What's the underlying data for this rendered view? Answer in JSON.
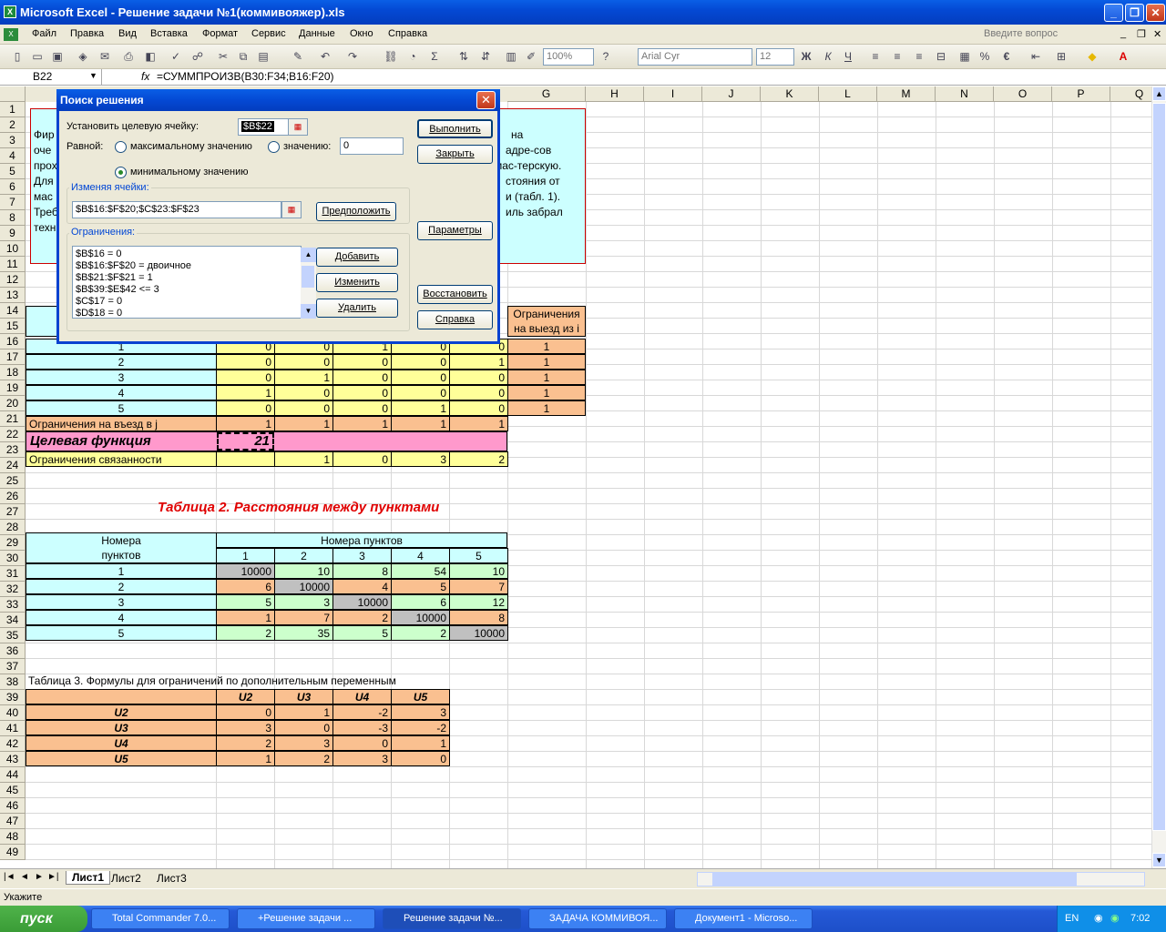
{
  "window": {
    "title": "Microsoft Excel - Решение задачи №1(коммивояжер).xls"
  },
  "menu": [
    "Файл",
    "Правка",
    "Вид",
    "Вставка",
    "Формат",
    "Сервис",
    "Данные",
    "Окно",
    "Справка"
  ],
  "ask_placeholder": "Введите вопрос",
  "toolbar": {
    "zoom": "100%",
    "font": "Arial Cyr",
    "size": "12"
  },
  "formula_bar": {
    "name_box": "B22",
    "fx": "fx",
    "formula": "=СУММПРОИЗВ(B30:F34;B16:F20)"
  },
  "columns": [
    "G",
    "H",
    "I",
    "J",
    "K",
    "L",
    "M",
    "N",
    "O",
    "P",
    "Q"
  ],
  "cells": {
    "r2": "Фир",
    "r3": "оче",
    "r4": "прох",
    "r5": "Для",
    "r6": "мас",
    "r7": "Треб",
    "r8": "техн",
    "r2b": "на",
    "r3b": "адре-сов",
    "r4b": "мас-терскую.",
    "r5b": "стояния от",
    "r6b": "и (табл. 1).",
    "r7b": "иль забрал",
    "g14": "Ограничения",
    "g15": "на выезд из i",
    "b16row": [
      "1",
      "0",
      "0",
      "1",
      "0",
      "0",
      "1"
    ],
    "rows16_20": [
      [
        "1",
        "0",
        "0",
        "1",
        "0",
        "0",
        "1"
      ],
      [
        "2",
        "0",
        "0",
        "0",
        "0",
        "1",
        "1"
      ],
      [
        "3",
        "0",
        "1",
        "0",
        "0",
        "0",
        "1"
      ],
      [
        "4",
        "1",
        "0",
        "0",
        "0",
        "0",
        "1"
      ],
      [
        "5",
        "0",
        "0",
        "0",
        "1",
        "0",
        "1"
      ]
    ],
    "r21": [
      "Ограничения на въезд в j",
      "1",
      "1",
      "1",
      "1",
      "1"
    ],
    "r22": [
      "Целевая функция",
      "21"
    ],
    "r23": [
      "Ограничения связанности",
      "",
      "1",
      "0",
      "3",
      "2"
    ],
    "t2title": "Таблица 2. Расстояния между пунктами",
    "t2_h1": "Номера",
    "t2_h2": "пунктов",
    "t2_h3": "Номера пунктов",
    "t2_cols": [
      "1",
      "2",
      "3",
      "4",
      "5"
    ],
    "t2_rows": [
      [
        "1",
        "10000",
        "10",
        "8",
        "54",
        "10"
      ],
      [
        "2",
        "6",
        "10000",
        "4",
        "5",
        "7"
      ],
      [
        "3",
        "5",
        "3",
        "10000",
        "6",
        "12"
      ],
      [
        "4",
        "1",
        "7",
        "2",
        "10000",
        "8"
      ],
      [
        "5",
        "2",
        "35",
        "5",
        "2",
        "10000"
      ]
    ],
    "t3title": "Таблица 3. Формулы для ограничений по дополнительным переменным",
    "t3_cols": [
      "U2",
      "U3",
      "U4",
      "U5"
    ],
    "t3_rows": [
      [
        "U2",
        "0",
        "1",
        "-2",
        "3"
      ],
      [
        "U3",
        "3",
        "0",
        "-3",
        "-2"
      ],
      [
        "U4",
        "2",
        "3",
        "0",
        "1"
      ],
      [
        "U5",
        "1",
        "2",
        "3",
        "0"
      ]
    ]
  },
  "dialog": {
    "title": "Поиск решения",
    "target_label": "Установить целевую ячейку:",
    "target_value": "$B$22",
    "equal_label": "Равной:",
    "opt_max": "максимальному значению",
    "opt_value": "значению:",
    "value_input": "0",
    "opt_min": "минимальному значению",
    "changing_label": "Изменяя ячейки:",
    "changing_value": "$B$16:$F$20;$C$23:$F$23",
    "guess": "Предположить",
    "constraints_label": "Ограничения:",
    "constraints": [
      "$B$16 = 0",
      "$B$16:$F$20 = двоичное",
      "$B$21:$F$21 = 1",
      "$B$39:$E$42 <= 3",
      "$C$17 = 0",
      "$D$18 = 0"
    ],
    "add": "Добавить",
    "change": "Изменить",
    "delete": "Удалить",
    "solve": "Выполнить",
    "close": "Закрыть",
    "options": "Параметры",
    "reset": "Восстановить",
    "help": "Справка"
  },
  "tabs": [
    "Лист1",
    "Лист2",
    "Лист3"
  ],
  "status": "Укажите",
  "taskbar": {
    "start": "пуск",
    "items": [
      "Total Commander 7.0...",
      "+Решение задачи ...",
      "Решение задачи №...",
      "ЗАДАЧА КОММИВОЯ...",
      "Документ1 - Microso..."
    ],
    "lang": "EN",
    "time": "7:02"
  }
}
